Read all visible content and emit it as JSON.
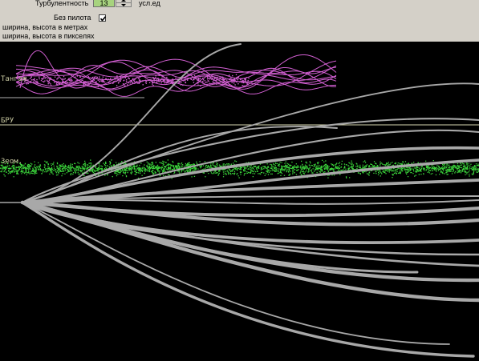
{
  "controls": {
    "turbulence_label": "Турбулентность",
    "turbulence_value": "13",
    "turbulence_units": "усл.ед",
    "autopilot_label": "Без пилота",
    "autopilot_checked": true,
    "size_meters_label": "ширина, высота  в метрах",
    "size_pixels_label": "ширина, высота  в пикселях"
  },
  "plot": {
    "pitch_label": "Тангаж",
    "bru_label": "БРУ",
    "noise_label": "Зеом.",
    "colors": {
      "pitch": "#d25fd2",
      "noise": "#3ad23a",
      "trajectory": "#a8a8a8",
      "bru_line": "#d6d6b0",
      "label": "#c8c8a0"
    }
  }
}
